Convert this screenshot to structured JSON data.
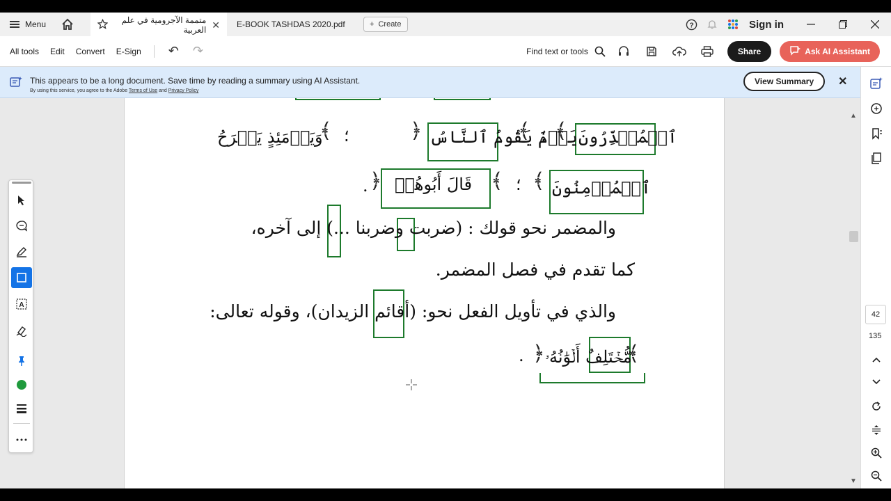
{
  "window": {
    "menu_label": "Menu",
    "tabs": [
      {
        "label": "متممة الآجرومية في علم العربية"
      },
      {
        "label": "E-BOOK TASHDAS 2020.pdf"
      }
    ],
    "create_label": "Create",
    "signin_label": "Sign in"
  },
  "toolbar": {
    "all_tools": "All tools",
    "edit": "Edit",
    "convert": "Convert",
    "esign": "E-Sign",
    "find_label": "Find text or tools",
    "share_label": "Share",
    "ai_label": "Ask AI Assistant"
  },
  "banner": {
    "text": "This appears to be a long document. Save time by reading a summary using AI Assistant.",
    "sub_prefix": "By using this service, you agree to the Adobe",
    "terms": "Terms of Use",
    "and": "and",
    "privacy": "Privacy Policy",
    "view_summary": "View Summary"
  },
  "document": {
    "line1": {
      "w1": "ٱلۡمُعۡذِّرُونَ",
      "w2": "يَوۡمَ يَقُومُ ٱلنَّاسُ",
      "w3": "وَيَوۡمَئِذٍ يَفۡرَحُ",
      "comma": "؛"
    },
    "line2": {
      "w1": "ٱلۡمُؤۡمِنُونَ",
      "w2": "قَالَ أَبُوهُمۡ",
      "comma": "؛",
      "dot": "."
    },
    "line3": "والمضمر نحو قولك : (ضربت وضربنا ...) إلى آخره،",
    "line4": "كما تقدم في فصل المضمر.",
    "line5": "والذي في تأويل الفعل نحو: (أقائم الزيدان)، وقوله تعالى:",
    "line6": {
      "w1": "مُّخۡتَلِفٌ أَلۡوَٰنُهُۥ",
      "dot": "."
    }
  },
  "page_nav": {
    "current": "42",
    "total": "135"
  },
  "colors": {
    "highlight_box": "#1d7a2c",
    "ai_button": "#e8635a",
    "selected_tool": "#1473e6",
    "banner_bg": "#dcebfb"
  }
}
